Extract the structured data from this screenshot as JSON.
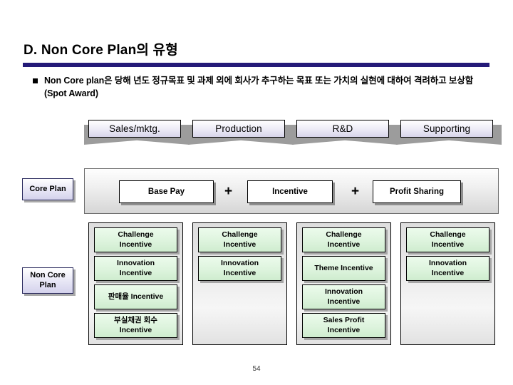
{
  "slide": {
    "title": "D. Non Core Plan의 유형",
    "bullet": "Non Core plan은 당해 년도 정규목표 및 과제 외에 회사가 추구하는 목표 또는 가치의 실현에 대하여 격려하고 보상함 (Spot Award)",
    "page_number": "54",
    "accent_color": "#241a78",
    "green_box_color": "#dcf3dc",
    "label_color": "#d4d2ec"
  },
  "columns": [
    {
      "header": "Sales/mktg."
    },
    {
      "header": "Production"
    },
    {
      "header": "R&D"
    },
    {
      "header": "Supporting"
    }
  ],
  "rows": {
    "core_plan": {
      "label": "Core Plan",
      "items": [
        {
          "label": "Base Pay"
        },
        {
          "label": "Incentive"
        },
        {
          "label": "Profit Sharing"
        }
      ],
      "operators": [
        "+",
        "+"
      ]
    },
    "non_core_plan": {
      "label_line1": "Non Core",
      "label_line2": "Plan",
      "columns": [
        {
          "items": [
            {
              "line1": "Challenge",
              "line2": "Incentive"
            },
            {
              "line1": "Innovation",
              "line2": "Incentive"
            },
            {
              "line1": "판매율 Incentive",
              "line2": ""
            },
            {
              "line1": "부실채권 회수",
              "line2": "Incentive"
            }
          ]
        },
        {
          "items": [
            {
              "line1": "Challenge",
              "line2": "Incentive"
            },
            {
              "line1": "Innovation",
              "line2": "Incentive"
            }
          ]
        },
        {
          "items": [
            {
              "line1": "Challenge",
              "line2": "Incentive"
            },
            {
              "line1": "Theme Incentive",
              "line2": ""
            },
            {
              "line1": "Innovation",
              "line2": "Incentive"
            },
            {
              "line1": "Sales Profit",
              "line2": "Incentive"
            }
          ]
        },
        {
          "items": [
            {
              "line1": "Challenge",
              "line2": "Incentive"
            },
            {
              "line1": "Innovation",
              "line2": "Incentive"
            }
          ]
        }
      ]
    }
  }
}
